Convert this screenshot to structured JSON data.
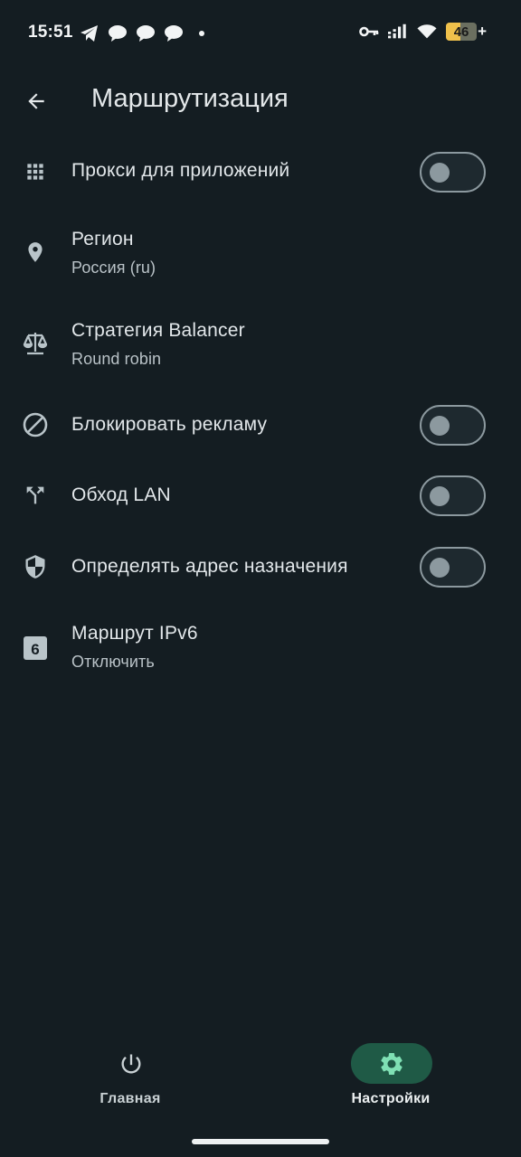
{
  "status_bar": {
    "time": "15:51",
    "battery_level": 46,
    "battery_label": "46",
    "charging_symbol": "+",
    "left_icons": [
      "telegram-icon",
      "chat-bubble-icon",
      "chat-bubble-icon",
      "chat-bubble-icon",
      "dot-icon"
    ],
    "right_icons": [
      "vpn-key-icon",
      "signal-icon",
      "wifi-icon",
      "battery-icon"
    ]
  },
  "app_bar": {
    "title": "Маршрутизация",
    "back_icon": "arrow-back-icon"
  },
  "settings": [
    {
      "icon": "apps-grid-icon",
      "title": "Прокси для приложений",
      "toggle": false
    },
    {
      "icon": "location-pin-icon",
      "title": "Регион",
      "subtitle": "Россия (ru)"
    },
    {
      "icon": "balance-scale-icon",
      "title": "Стратегия Balancer",
      "subtitle": "Round robin"
    },
    {
      "icon": "block-icon",
      "title": "Блокировать рекламу",
      "toggle": false
    },
    {
      "icon": "fork-arrows-icon",
      "title": "Обход LAN",
      "toggle": false
    },
    {
      "icon": "shield-icon",
      "title": "Определять адрес назначения",
      "toggle": false
    },
    {
      "icon": "number-six-box-icon",
      "title": "Маршрут IPv6",
      "subtitle": "Отключить"
    }
  ],
  "bottom_nav": {
    "items": [
      {
        "label": "Главная",
        "icon": "power-icon",
        "active": false
      },
      {
        "label": "Настройки",
        "icon": "gear-icon",
        "active": true
      }
    ]
  },
  "colors": {
    "background": "#141d22",
    "accent_pill": "#1f5a46",
    "accent_icon": "#7fe0b4",
    "toggle_off": "#8c999f",
    "battery_fill": "#f0c14b"
  }
}
